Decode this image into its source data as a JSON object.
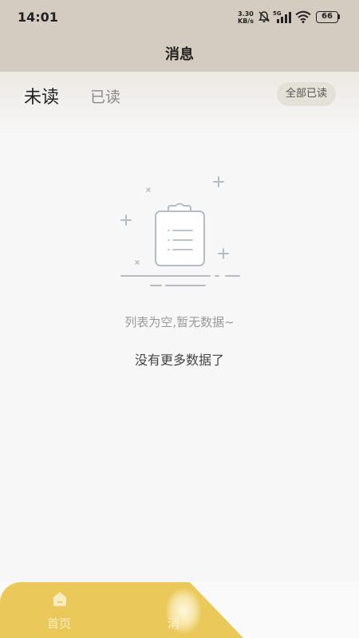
{
  "status_bar": {
    "time": "14:01",
    "net_speed_value": "3.30",
    "net_speed_unit": "KB/s",
    "network_type": "5G",
    "battery": "66",
    "icons": [
      "mute-bell-icon",
      "signal-icon",
      "wifi-icon",
      "battery-icon"
    ]
  },
  "header": {
    "title": "消息"
  },
  "tabs": {
    "unread": "未读",
    "read": "已读",
    "mark_all_read": "全部已读"
  },
  "empty_state": {
    "icon": "clipboard-icon",
    "message": "列表为空,暂无数据~",
    "no_more": "没有更多数据了"
  },
  "bottom_nav": {
    "items": [
      {
        "label": "首页",
        "icon": "home-icon"
      },
      {
        "label": "消息",
        "icon": "message-icon"
      }
    ],
    "active_color": "#eac95a"
  },
  "colors": {
    "header_bg": "#d5ccc1",
    "page_bg": "#f7f7f7",
    "accent": "#eac95a"
  }
}
